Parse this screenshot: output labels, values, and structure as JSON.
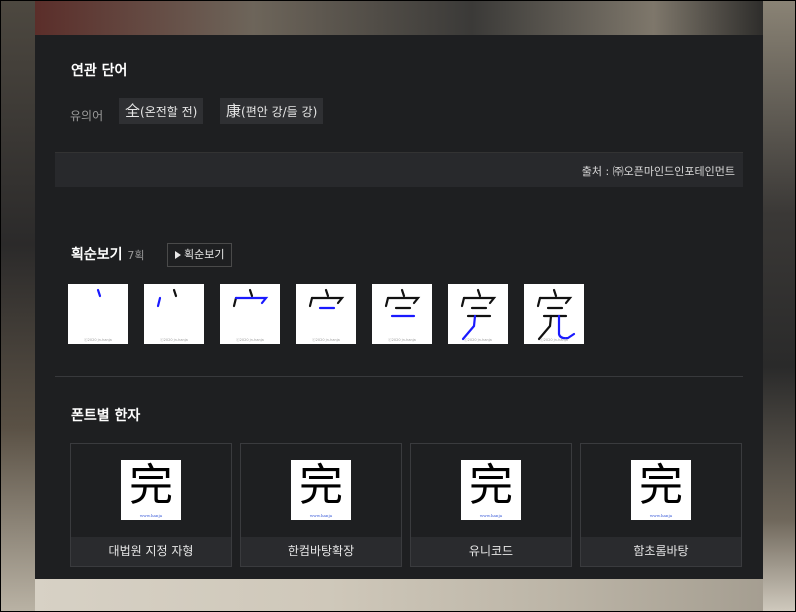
{
  "related": {
    "title": "연관 단어",
    "synonym_label": "유의어",
    "synonyms": [
      {
        "hanja": "全",
        "reading": "(온전할 전)"
      },
      {
        "hanja": "康",
        "reading": "(편안 강/들 강)"
      }
    ],
    "source": "출처 : ㈜오픈마인드인포테인먼트"
  },
  "strokes": {
    "title": "획순보기",
    "count": "7획",
    "button_label": "획순보기",
    "watermark": "ⓒ2020 jn-hanja",
    "steps": [
      1,
      2,
      3,
      4,
      5,
      6,
      7
    ]
  },
  "fonts": {
    "title": "폰트별 한자",
    "glyph": "完",
    "watermark": "www.hanja",
    "items": [
      {
        "name": "대법원 지정 자형"
      },
      {
        "name": "한컴바탕확장"
      },
      {
        "name": "유니코드"
      },
      {
        "name": "함초롬바탕"
      }
    ]
  },
  "colors": {
    "panel_bg": "#1e1f21",
    "stroke_highlight": "#1a1aff"
  }
}
